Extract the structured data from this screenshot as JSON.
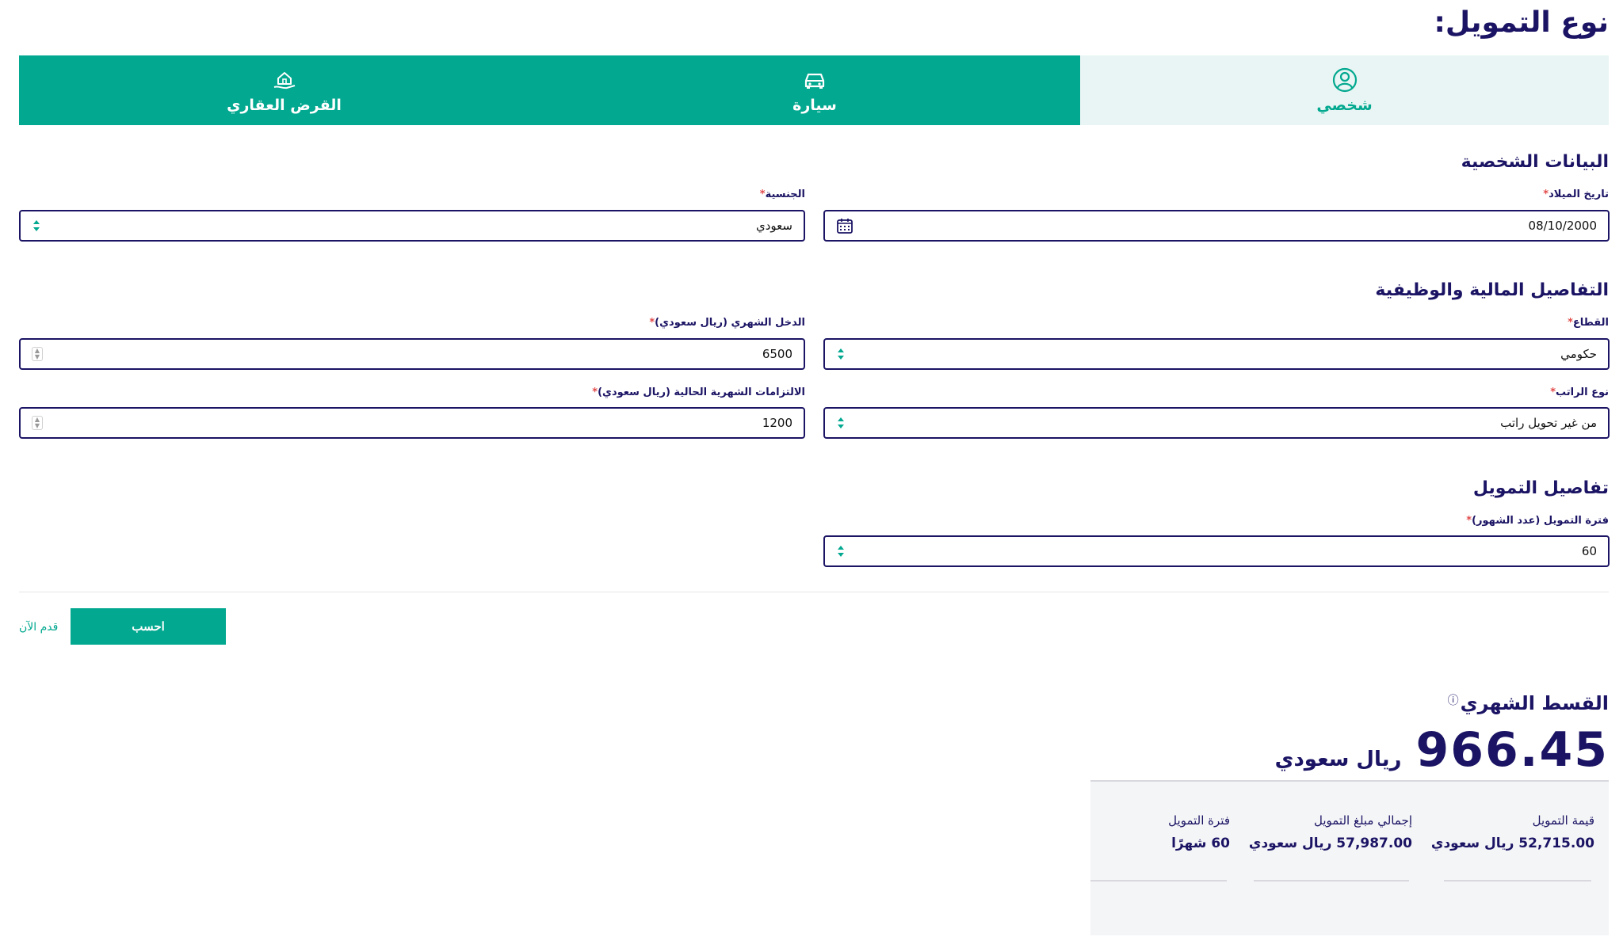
{
  "page": {
    "title": "نوع التمويل:"
  },
  "tabs": [
    {
      "label": "شخصي",
      "icon": "user-circle-icon",
      "active": true
    },
    {
      "label": "سيارة",
      "icon": "car-icon",
      "active": false
    },
    {
      "label": "القرض العقاري",
      "icon": "house-hand-icon",
      "active": false
    }
  ],
  "personal": {
    "section_title": "البيانات الشخصية",
    "birthdate": {
      "label": "تاريخ الميلاد",
      "value": "08/10/2000"
    },
    "nationality": {
      "label": "الجنسية",
      "value": "سعودي"
    }
  },
  "financial": {
    "section_title": "التفاصيل المالية والوظيفية",
    "sector": {
      "label": "القطاع",
      "value": "حكومي"
    },
    "income": {
      "label": "الدخل الشهري (ريال سعودي)",
      "value": "6500"
    },
    "salary_type": {
      "label": "نوع الراتب",
      "value": "من غير تحويل راتب"
    },
    "obligations": {
      "label": "الالتزامات الشهرية الحالية (ريال سعودي)",
      "value": "1200"
    }
  },
  "finance_details": {
    "section_title": "تفاصيل التمويل",
    "period": {
      "label": "فترة التمويل (عدد الشهور)",
      "value": "60"
    }
  },
  "actions": {
    "calculate": "احسب",
    "apply": "قدم الآن"
  },
  "result": {
    "title": "القسط الشهري",
    "info_icon": "ⓘ",
    "amount": "966.45",
    "currency": "ريال سعودي"
  },
  "summary": [
    {
      "label": "قيمة التمويل",
      "value": "52,715.00 ريال سعودي"
    },
    {
      "label": "إجمالي مبلغ التمويل",
      "value": "57,987.00 ريال سعودي"
    },
    {
      "label": "فترة التمويل",
      "value": "60 شهرًا"
    }
  ],
  "colors": {
    "primary": "#02a88f",
    "navy": "#1b1464",
    "tab_active_bg": "#e8f5f4",
    "required": "#e24a4a"
  }
}
